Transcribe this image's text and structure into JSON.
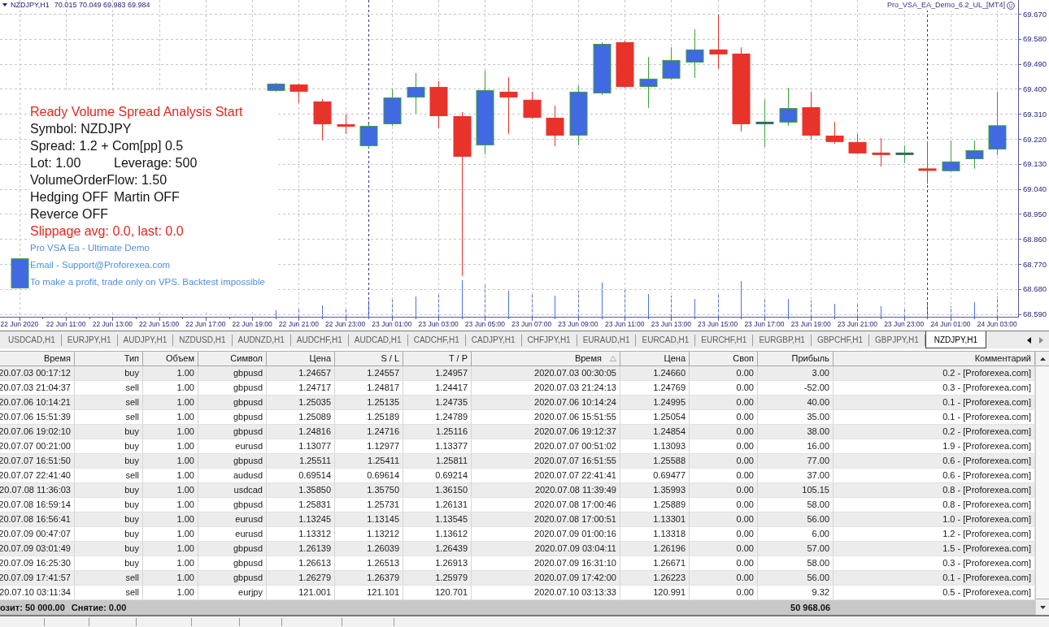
{
  "chart": {
    "header": {
      "symbol": "NZDJPY,H1",
      "quote": "70.015 70.049 69.983 69.984"
    },
    "expert": {
      "name": "Pro_VSA_EA_Demo_6.2_UL_[MT4]"
    },
    "info_panel": {
      "lines": [
        {
          "kind": "alert",
          "texts": [
            "Ready Volume Spread Analysis Start"
          ]
        },
        {
          "kind": "info",
          "texts": [
            "Symbol: NZDJPY"
          ]
        },
        {
          "kind": "info",
          "texts": [
            "Spread: 1.2 + Com[pp] 0.5"
          ]
        },
        {
          "kind": "info",
          "texts": [
            "Lot: 1.00",
            "Leverage: 500"
          ]
        },
        {
          "kind": "info",
          "texts": [
            "VolumeOrderFlow: 1.50"
          ]
        },
        {
          "kind": "info",
          "texts": [
            "Hedging OFF",
            "Martin OFF"
          ]
        },
        {
          "kind": "info",
          "texts": [
            "Reverce OFF"
          ]
        },
        {
          "kind": "alert",
          "texts": [
            "Slippage avg: 0.0, last: 0.0"
          ]
        },
        {
          "kind": "note",
          "texts": [
            "Pro VSA Ea - Ultimate Demo"
          ]
        },
        {
          "kind": "note",
          "texts": [
            "Email - Support@Proforexea.com"
          ]
        },
        {
          "kind": "note",
          "texts": [
            "To make a profit, trade only on VPS. Backtest impossible"
          ]
        }
      ]
    },
    "chart_data": [
      {
        "type": "candlestick",
        "x": [
          "2020-06-22T09:00",
          "2020-06-22T20:00",
          "2020-06-22T21:00",
          "2020-06-22T22:00",
          "2020-06-22T23:00",
          "2020-06-23T00:00",
          "2020-06-23T01:00",
          "2020-06-23T02:00",
          "2020-06-23T03:00",
          "2020-06-23T04:00",
          "2020-06-23T05:00",
          "2020-06-23T06:00",
          "2020-06-23T07:00",
          "2020-06-23T08:00",
          "2020-06-23T09:00",
          "2020-06-23T10:00",
          "2020-06-23T11:00",
          "2020-06-23T12:00",
          "2020-06-23T13:00",
          "2020-06-23T14:00",
          "2020-06-23T15:00",
          "2020-06-23T16:00",
          "2020-06-23T17:00",
          "2020-06-23T18:00",
          "2020-06-23T19:00",
          "2020-06-23T20:00",
          "2020-06-23T21:00",
          "2020-06-23T22:00",
          "2020-06-23T23:00",
          "2020-06-24T00:00",
          "2020-06-24T01:00",
          "2020-06-24T02:00",
          "2020-06-24T03:00"
        ],
        "ohlc": [
          [
            68.682,
            68.79,
            68.682,
            68.79
          ],
          [
            69.393,
            69.422,
            69.39,
            69.419
          ],
          [
            69.416,
            69.419,
            69.349,
            69.39
          ],
          [
            69.355,
            69.363,
            69.215,
            69.273
          ],
          [
            69.27,
            69.308,
            69.238,
            69.267
          ],
          [
            69.194,
            69.273,
            69.188,
            69.267
          ],
          [
            69.273,
            69.399,
            69.267,
            69.369
          ],
          [
            69.369,
            69.457,
            69.311,
            69.407
          ],
          [
            69.407,
            69.428,
            69.258,
            69.302
          ],
          [
            69.302,
            69.317,
            68.727,
            69.156
          ],
          [
            69.197,
            69.466,
            69.165,
            69.396
          ],
          [
            69.39,
            69.442,
            69.238,
            69.369
          ],
          [
            69.361,
            69.39,
            69.293,
            69.296
          ],
          [
            69.296,
            69.34,
            69.194,
            69.232
          ],
          [
            69.232,
            69.413,
            69.197,
            69.39
          ],
          [
            69.384,
            69.568,
            69.378,
            69.562
          ],
          [
            69.568,
            69.574,
            69.404,
            69.407
          ],
          [
            69.407,
            69.515,
            69.331,
            69.437
          ],
          [
            69.437,
            69.55,
            69.434,
            69.504
          ],
          [
            69.495,
            69.615,
            69.439,
            69.542
          ],
          [
            69.542,
            69.667,
            69.472,
            69.524
          ],
          [
            69.527,
            69.55,
            69.247,
            69.273
          ],
          [
            69.276,
            69.361,
            69.191,
            69.279
          ],
          [
            69.279,
            69.404,
            69.267,
            69.331
          ],
          [
            69.334,
            69.39,
            69.218,
            69.232
          ],
          [
            69.232,
            69.282,
            69.203,
            69.209
          ],
          [
            69.209,
            69.238,
            69.165,
            69.168
          ],
          [
            69.168,
            69.223,
            69.121,
            69.165
          ],
          [
            69.165,
            69.197,
            69.133,
            69.168
          ],
          [
            69.111,
            69.212,
            69.058,
            69.108
          ],
          [
            69.104,
            69.214,
            69.104,
            69.139
          ],
          [
            69.147,
            69.214,
            69.113,
            69.179
          ],
          [
            69.182,
            69.391,
            69.162,
            69.269
          ]
        ],
        "xlim": [
          "2020-06-22T08:10",
          "2020-06-24T03:54"
        ],
        "ylim": [
          68.58,
          69.72
        ],
        "xticks": [
          {
            "value": "2020-06-22T09:00",
            "label": "22 Jun 2020"
          },
          {
            "value": "2020-06-22T11:00",
            "label": "22 Jun 11:00"
          },
          {
            "value": "2020-06-22T13:00",
            "label": "22 Jun 13:00"
          },
          {
            "value": "2020-06-22T15:00",
            "label": "22 Jun 15:00"
          },
          {
            "value": "2020-06-22T17:00",
            "label": "22 Jun 17:00"
          },
          {
            "value": "2020-06-22T19:00",
            "label": "22 Jun 19:00"
          },
          {
            "value": "2020-06-22T21:00",
            "label": "22 Jun 21:00"
          },
          {
            "value": "2020-06-22T23:00",
            "label": "22 Jun 23:00"
          },
          {
            "value": "2020-06-23T01:00",
            "label": "23 Jun 01:00"
          },
          {
            "value": "2020-06-23T03:00",
            "label": "23 Jun 03:00"
          },
          {
            "value": "2020-06-23T05:00",
            "label": "23 Jun 05:00"
          },
          {
            "value": "2020-06-23T07:00",
            "label": "23 Jun 07:00"
          },
          {
            "value": "2020-06-23T09:00",
            "label": "23 Jun 09:00"
          },
          {
            "value": "2020-06-23T11:00",
            "label": "23 Jun 11:00"
          },
          {
            "value": "2020-06-23T13:00",
            "label": "23 Jun 13:00"
          },
          {
            "value": "2020-06-23T15:00",
            "label": "23 Jun 15:00"
          },
          {
            "value": "2020-06-23T17:00",
            "label": "23 Jun 17:00"
          },
          {
            "value": "2020-06-23T19:00",
            "label": "23 Jun 19:00"
          },
          {
            "value": "2020-06-23T21:00",
            "label": "23 Jun 21:00"
          },
          {
            "value": "2020-06-23T23:00",
            "label": "23 Jun 23:00"
          },
          {
            "value": "2020-06-24T01:00",
            "label": "24 Jun 01:00"
          },
          {
            "value": "2020-06-24T03:00",
            "label": "24 Jun 03:00"
          }
        ],
        "yticks": [
          {
            "value": 69.67,
            "label": "69.670"
          },
          {
            "value": 69.58,
            "label": "69.580"
          },
          {
            "value": 69.49,
            "label": "69.490"
          },
          {
            "value": 69.4,
            "label": "69.400"
          },
          {
            "value": 69.31,
            "label": "69.310"
          },
          {
            "value": 69.22,
            "label": "69.220"
          },
          {
            "value": 69.13,
            "label": "69.130"
          },
          {
            "value": 69.04,
            "label": "69.040"
          },
          {
            "value": 68.95,
            "label": "68.950"
          },
          {
            "value": 68.86,
            "label": "68.860"
          },
          {
            "value": 68.77,
            "label": "68.770"
          },
          {
            "value": 68.68,
            "label": "68.680"
          },
          {
            "value": 68.59,
            "label": "68.590"
          }
        ],
        "grid": true,
        "ref_lines": [
          {
            "axis": "x",
            "value": "2020-06-23T00:00",
            "color": "#2c2c96",
            "line_style": "dashed"
          },
          {
            "axis": "x",
            "value": "2020-06-24T00:00",
            "color": "#2c2c96",
            "line_style": "dashed"
          }
        ]
      }
    ]
  },
  "chart_tabs": {
    "tabs": [
      {
        "label": "USDCAD,H1",
        "selected": false
      },
      {
        "label": "EURJPY,H1",
        "selected": false
      },
      {
        "label": "AUDJPY,H1",
        "selected": false
      },
      {
        "label": "NZDUSD,H1",
        "selected": false
      },
      {
        "label": "AUDNZD,H1",
        "selected": false
      },
      {
        "label": "AUDCHF,H1",
        "selected": false
      },
      {
        "label": "AUDCAD,H1",
        "selected": false
      },
      {
        "label": "CADCHF,H1",
        "selected": false
      },
      {
        "label": "CADJPY,H1",
        "selected": false
      },
      {
        "label": "CHFJPY,H1",
        "selected": false
      },
      {
        "label": "EURAUD,H1",
        "selected": false
      },
      {
        "label": "EURCAD,H1",
        "selected": false
      },
      {
        "label": "EURCHF,H1",
        "selected": false
      },
      {
        "label": "EURGBP,H1",
        "selected": false
      },
      {
        "label": "GBPCHF,H1",
        "selected": false
      },
      {
        "label": "GBPJPY,H1",
        "selected": false
      },
      {
        "label": "NZDJPY,H1",
        "selected": true
      }
    ]
  },
  "trade_table": {
    "columns": [
      {
        "label": "Время",
        "sorted": false
      },
      {
        "label": "Тип",
        "sorted": false
      },
      {
        "label": "Объем",
        "sorted": false
      },
      {
        "label": "Символ",
        "sorted": false
      },
      {
        "label": "Цена",
        "sorted": false
      },
      {
        "label": "S / L",
        "sorted": false
      },
      {
        "label": "T / P",
        "sorted": false
      },
      {
        "label": "Время",
        "sorted": true
      },
      {
        "label": "Цена",
        "sorted": false
      },
      {
        "label": "Своп",
        "sorted": false
      },
      {
        "label": "Прибыль",
        "sorted": false
      },
      {
        "label": "Комментарий",
        "sorted": false
      }
    ],
    "rows": [
      [
        "20.07.03 00:17:12",
        "buy",
        "1.00",
        "gbpusd",
        "1.24657",
        "1.24557",
        "1.24957",
        "2020.07.03 00:30:05",
        "1.24660",
        "0.00",
        "3.00",
        "0.2 - [Proforexea.com]"
      ],
      [
        "20.07.03 21:04:37",
        "sell",
        "1.00",
        "gbpusd",
        "1.24717",
        "1.24817",
        "1.24417",
        "2020.07.03 21:24:13",
        "1.24769",
        "0.00",
        "-52.00",
        "0.3 - [Proforexea.com]"
      ],
      [
        "20.07.06 10:14:21",
        "sell",
        "1.00",
        "gbpusd",
        "1.25035",
        "1.25135",
        "1.24735",
        "2020.07.06 10:14:24",
        "1.24995",
        "0.00",
        "40.00",
        "0.1 - [Proforexea.com]"
      ],
      [
        "20.07.06 15:51:39",
        "sell",
        "1.00",
        "gbpusd",
        "1.25089",
        "1.25189",
        "1.24789",
        "2020.07.06 15:51:55",
        "1.25054",
        "0.00",
        "35.00",
        "0.1 - [Proforexea.com]"
      ],
      [
        "20.07.06 19:02:10",
        "buy",
        "1.00",
        "gbpusd",
        "1.24816",
        "1.24716",
        "1.25116",
        "2020.07.06 19:12:37",
        "1.24854",
        "0.00",
        "38.00",
        "0.2 - [Proforexea.com]"
      ],
      [
        "20.07.07 00:21:00",
        "buy",
        "1.00",
        "eurusd",
        "1.13077",
        "1.12977",
        "1.13377",
        "2020.07.07 00:51:02",
        "1.13093",
        "0.00",
        "16.00",
        "1.9 - [Proforexea.com]"
      ],
      [
        "20.07.07 16:51:50",
        "buy",
        "1.00",
        "gbpusd",
        "1.25511",
        "1.25411",
        "1.25811",
        "2020.07.07 16:51:55",
        "1.25588",
        "0.00",
        "77.00",
        "0.6 - [Proforexea.com]"
      ],
      [
        "20.07.07 22:41:40",
        "sell",
        "1.00",
        "audusd",
        "0.69514",
        "0.69614",
        "0.69214",
        "2020.07.07 22:41:41",
        "0.69477",
        "0.00",
        "37.00",
        "0.6 - [Proforexea.com]"
      ],
      [
        "20.07.08 11:36:03",
        "buy",
        "1.00",
        "usdcad",
        "1.35850",
        "1.35750",
        "1.36150",
        "2020.07.08 11:39:49",
        "1.35993",
        "0.00",
        "105.15",
        "0.8 - [Proforexea.com]"
      ],
      [
        "20.07.08 16:59:14",
        "buy",
        "1.00",
        "gbpusd",
        "1.25831",
        "1.25731",
        "1.26131",
        "2020.07.08 17:00:46",
        "1.25889",
        "0.00",
        "58.00",
        "0.8 - [Proforexea.com]"
      ],
      [
        "20.07.08 16:56:41",
        "buy",
        "1.00",
        "eurusd",
        "1.13245",
        "1.13145",
        "1.13545",
        "2020.07.08 17:00:51",
        "1.13301",
        "0.00",
        "56.00",
        "1.0 - [Proforexea.com]"
      ],
      [
        "20.07.09 00:47:07",
        "buy",
        "1.00",
        "eurusd",
        "1.13312",
        "1.13212",
        "1.13612",
        "2020.07.09 01:00:16",
        "1.13318",
        "0.00",
        "6.00",
        "1.2 - [Proforexea.com]"
      ],
      [
        "20.07.09 03:01:49",
        "buy",
        "1.00",
        "gbpusd",
        "1.26139",
        "1.26039",
        "1.26439",
        "2020.07.09 03:04:11",
        "1.26196",
        "0.00",
        "57.00",
        "1.5 - [Proforexea.com]"
      ],
      [
        "20.07.09 16:25:30",
        "buy",
        "1.00",
        "gbpusd",
        "1.26613",
        "1.26513",
        "1.26913",
        "2020.07.09 16:31:10",
        "1.26671",
        "0.00",
        "58.00",
        "0.3 - [Proforexea.com]"
      ],
      [
        "20.07.09 17:41:57",
        "sell",
        "1.00",
        "gbpusd",
        "1.26279",
        "1.26379",
        "1.25979",
        "2020.07.09 17:42:00",
        "1.26223",
        "0.00",
        "56.00",
        "0.1 - [Proforexea.com]"
      ],
      [
        "20.07.10 03:11:34",
        "sell",
        "1.00",
        "eurjpy",
        "121.001",
        "121.101",
        "120.701",
        "2020.07.10 03:13:33",
        "120.991",
        "0.00",
        "9.32",
        "0.5 - [Proforexea.com]"
      ]
    ],
    "footer": {
      "texts": [
        "озит: 50 000.00",
        "Снятие: 0.00"
      ],
      "total": "50 968.06"
    }
  }
}
